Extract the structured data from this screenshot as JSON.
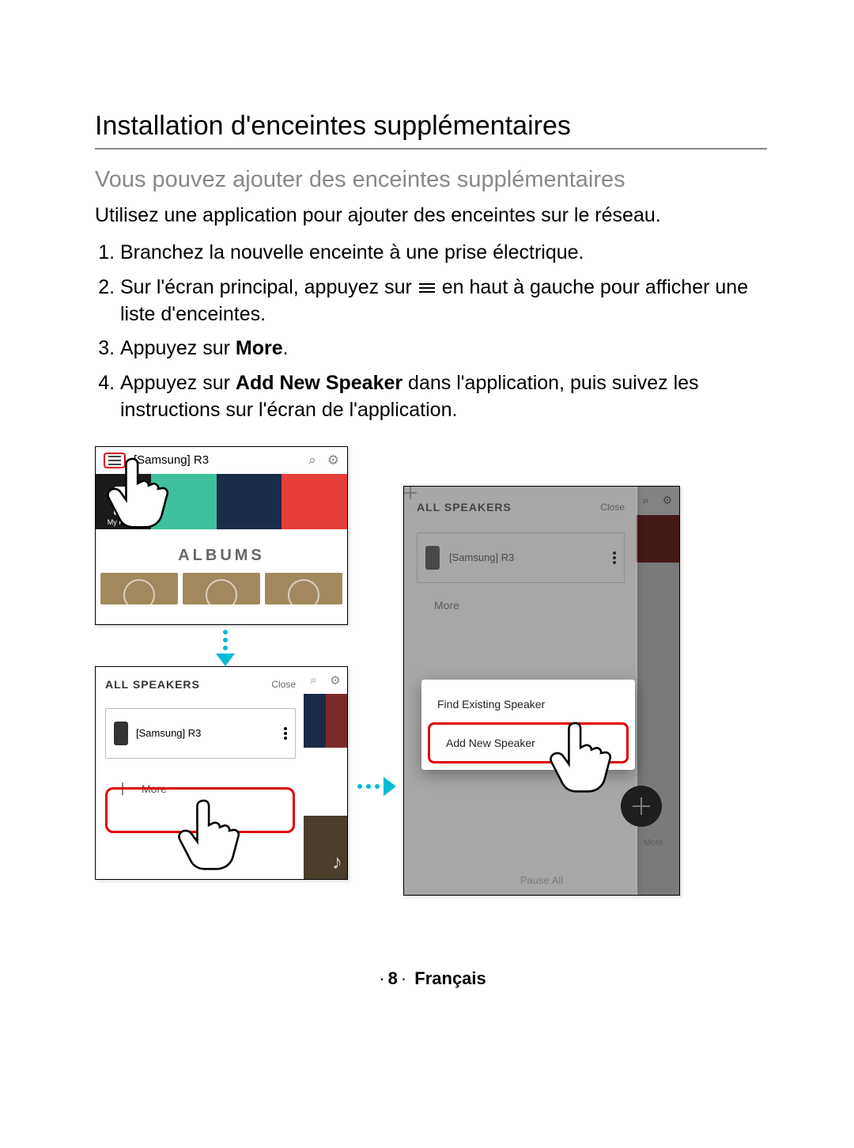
{
  "section_title": "Installation d'enceintes supplémentaires",
  "subtitle": "Vous pouvez ajouter des enceintes supplémentaires",
  "intro": "Utilisez une application pour ajouter des enceintes sur le réseau.",
  "steps": {
    "s1": "Branchez la nouvelle enceinte à une prise électrique.",
    "s2a": "Sur l'écran principal, appuyez sur ",
    "s2b": " en haut à gauche pour afficher une liste d'enceintes.",
    "s3a": "Appuyez sur ",
    "s3b": "More",
    "s3c": ".",
    "s4a": "Appuyez sur ",
    "s4b": "Add New Speaker",
    "s4c": " dans l'application, puis suivez les instructions sur l'écran de l'application."
  },
  "shot1": {
    "device_label": "[Samsung] R3",
    "myphone": "My Phone",
    "albums": "ALBUMS"
  },
  "panel": {
    "title": "ALL SPEAKERS",
    "close": "Close",
    "speaker": "[Samsung] R3",
    "more": "More",
    "pause": "Pause All",
    "fab_label": "More"
  },
  "popup": {
    "find": "Find Existing Speaker",
    "add": "Add New Speaker"
  },
  "footer": {
    "page": "8",
    "lang": "Français"
  }
}
